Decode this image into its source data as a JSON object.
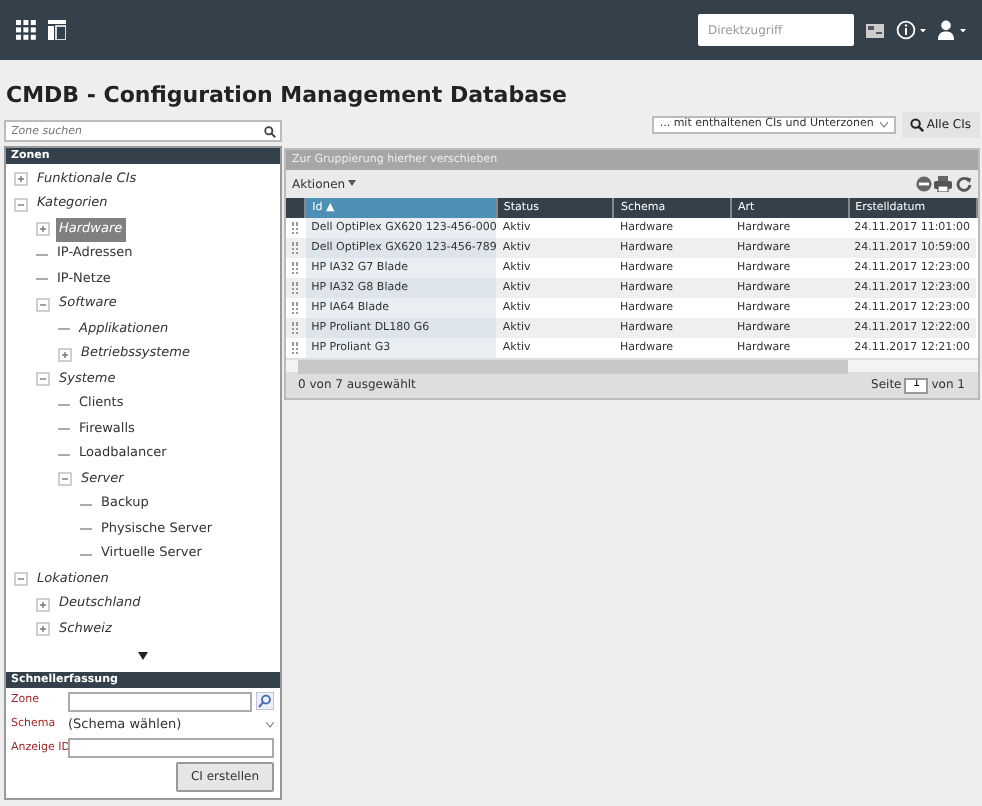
{
  "navbar": {
    "search": {
      "placeholder": "Direktzugriff"
    }
  },
  "title": "CMDB - Configuration Management Database",
  "zone_search": {
    "placeholder": "Zone suchen"
  },
  "filter": {
    "select": "... mit enthaltenen CIs und Unterzonen",
    "button": "Alle CIs"
  },
  "tree": {
    "header": "Zonen",
    "items": [
      {
        "label": "Funktionale CIs",
        "kind": "group",
        "expanded": false,
        "selected": false
      },
      {
        "label": "Kategorien",
        "kind": "group",
        "expanded": true,
        "selected": false,
        "children": [
          {
            "label": "Hardware",
            "kind": "group",
            "expanded": false,
            "selected": true
          },
          {
            "label": "IP-Adressen",
            "kind": "zone",
            "selected": false
          },
          {
            "label": "IP-Netze",
            "kind": "zone",
            "selected": false
          },
          {
            "label": "Software",
            "kind": "group",
            "expanded": true,
            "selected": false,
            "children": [
              {
                "label": "Applikationen",
                "kind": "group",
                "selected": false
              },
              {
                "label": "Betriebssysteme",
                "kind": "group",
                "expanded": false,
                "selected": false
              }
            ]
          },
          {
            "label": "Systeme",
            "kind": "group",
            "expanded": true,
            "selected": false,
            "children": [
              {
                "label": "Clients",
                "kind": "zone",
                "selected": false
              },
              {
                "label": "Firewalls",
                "kind": "zone",
                "selected": false
              },
              {
                "label": "Loadbalancer",
                "kind": "zone",
                "selected": false
              },
              {
                "label": "Server",
                "kind": "group",
                "expanded": true,
                "selected": false,
                "children": [
                  {
                    "label": "Backup",
                    "kind": "zone",
                    "selected": false
                  },
                  {
                    "label": "Physische Server",
                    "kind": "zone",
                    "selected": false
                  },
                  {
                    "label": "Virtuelle Server",
                    "kind": "zone",
                    "selected": false
                  }
                ]
              }
            ]
          }
        ]
      },
      {
        "label": "Lokationen",
        "kind": "group",
        "expanded": true,
        "selected": false,
        "children": [
          {
            "label": "Deutschland",
            "kind": "group",
            "expanded": false,
            "selected": false
          },
          {
            "label": "Schweiz",
            "kind": "group",
            "expanded": false,
            "selected": false
          }
        ]
      }
    ]
  },
  "quick_entry": {
    "header": "Schnellerfassung",
    "zone_label": "Zone",
    "schema_label": "Schema",
    "schema_value": "(Schema wählen)",
    "id_label": "Anzeige ID",
    "button": "CI erstellen"
  },
  "grid": {
    "group_hint": "Zur Gruppierung hierher verschieben",
    "actions": "Aktionen",
    "columns": [
      {
        "label": "Id",
        "sorted": true,
        "sort_mark": "▲"
      },
      {
        "label": "Status",
        "sorted": false
      },
      {
        "label": "Schema",
        "sorted": false
      },
      {
        "label": "Art",
        "sorted": false
      },
      {
        "label": "Erstelldatum",
        "sorted": false
      }
    ],
    "rows": [
      [
        "Dell OptiPlex GX620 123-456-000",
        "Aktiv",
        "Hardware",
        "Hardware",
        "24.11.2017 11:01:00"
      ],
      [
        "Dell OptiPlex GX620 123-456-789",
        "Aktiv",
        "Hardware",
        "Hardware",
        "24.11.2017 10:59:00"
      ],
      [
        "HP IA32 G7 Blade",
        "Aktiv",
        "Hardware",
        "Hardware",
        "24.11.2017 12:23:00"
      ],
      [
        "HP IA32 G8 Blade",
        "Aktiv",
        "Hardware",
        "Hardware",
        "24.11.2017 12:23:00"
      ],
      [
        "HP IA64 Blade",
        "Aktiv",
        "Hardware",
        "Hardware",
        "24.11.2017 12:23:00"
      ],
      [
        "HP Proliant DL180 G6",
        "Aktiv",
        "Hardware",
        "Hardware",
        "24.11.2017 12:22:00"
      ],
      [
        "HP Proliant G3",
        "Aktiv",
        "Hardware",
        "Hardware",
        "24.11.2017 12:21:00"
      ]
    ],
    "selection": "0 von 7 ausgewählt",
    "page_label": "Seite",
    "page": "1",
    "page_of": "von 1"
  }
}
